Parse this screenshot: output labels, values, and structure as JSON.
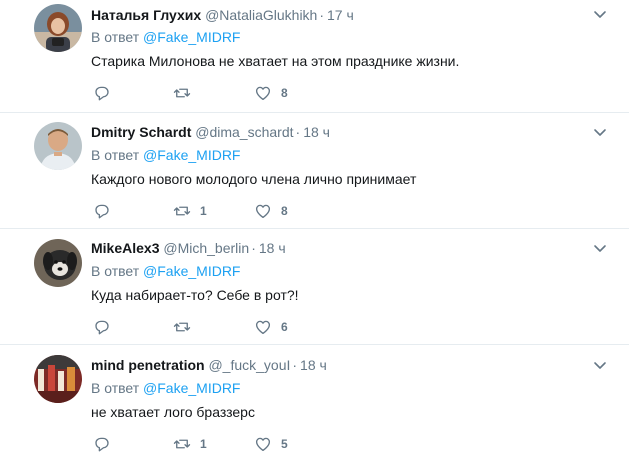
{
  "tweets": [
    {
      "display_name": "Наталья Глухих",
      "handle": "@NataliaGlukhikh",
      "time": "17 ч",
      "reply_prefix": "В ответ",
      "reply_to": "@Fake_MIDRF",
      "text": "Старика Милонова не хватает на этом празднике жизни.",
      "retweets": "",
      "likes": "8"
    },
    {
      "display_name": "Dmitry Schardt",
      "handle": "@dima_schardt",
      "time": "18 ч",
      "reply_prefix": "В ответ",
      "reply_to": "@Fake_MIDRF",
      "text": "Каждого нового молодого члена лично принимает",
      "retweets": "1",
      "likes": "8"
    },
    {
      "display_name": "MikeAlex3",
      "handle": "@Mich_berlin",
      "time": "18 ч",
      "reply_prefix": "В ответ",
      "reply_to": "@Fake_MIDRF",
      "text": "Куда набирает-то? Себе в рот?!",
      "retweets": "",
      "likes": "6"
    },
    {
      "display_name": "mind penetration",
      "handle": "@_fuck_youI",
      "time": "18 ч",
      "reply_prefix": "В ответ",
      "reply_to": "@Fake_MIDRF",
      "text": "не хватает лого браззерс",
      "retweets": "1",
      "likes": "5"
    }
  ],
  "icons": {
    "reply": "reply-icon",
    "retweet": "retweet-icon",
    "like": "heart-icon",
    "more": "chevron-down-icon"
  },
  "colors": {
    "link": "#1da1f2",
    "secondary_text": "#657786",
    "primary_text": "#14171a",
    "divider": "#e6ecf0"
  }
}
